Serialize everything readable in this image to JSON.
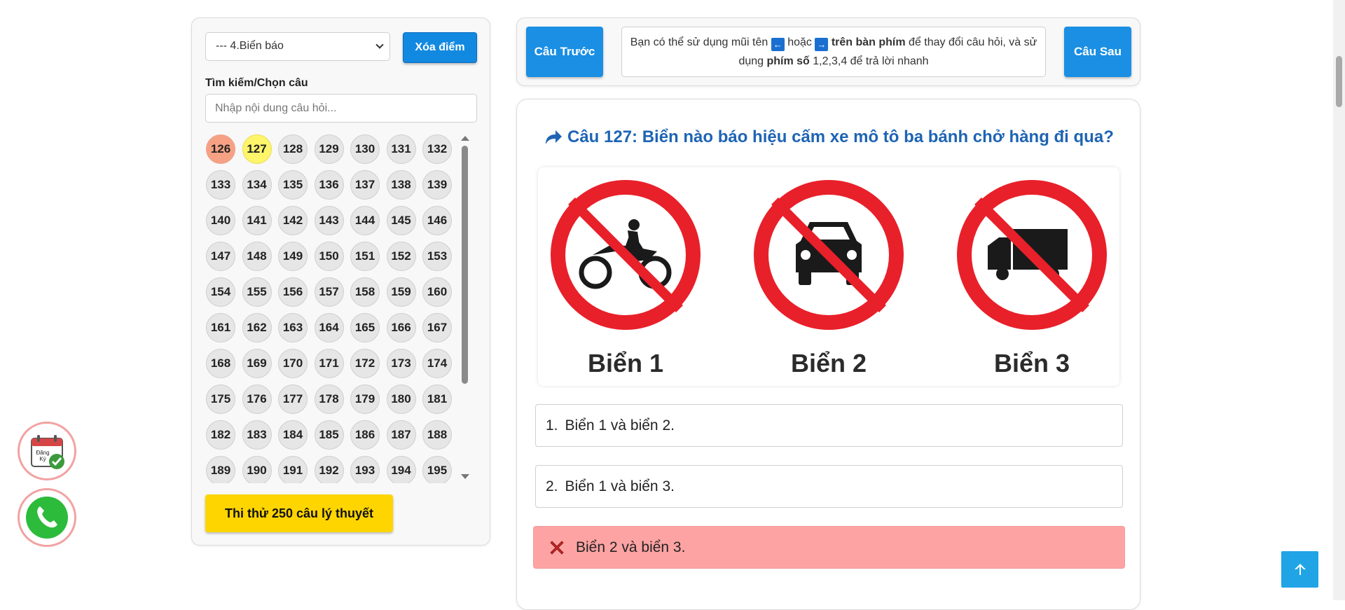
{
  "sidebar": {
    "topic_select": "--- 4.Biển báo",
    "clear_button": "Xóa điểm",
    "search_label": "Tìm kiếm/Chọn câu",
    "search_placeholder": "Nhập nội dung câu hỏi...",
    "question_numbers": [
      "126",
      "127",
      "128",
      "129",
      "130",
      "131",
      "132",
      "133",
      "134",
      "135",
      "136",
      "137",
      "138",
      "139",
      "140",
      "141",
      "142",
      "143",
      "144",
      "145",
      "146",
      "147",
      "148",
      "149",
      "150",
      "151",
      "152",
      "153",
      "154",
      "155",
      "156",
      "157",
      "158",
      "159",
      "160",
      "161",
      "162",
      "163",
      "164",
      "165",
      "166",
      "167",
      "168",
      "169",
      "170",
      "171",
      "172",
      "173",
      "174",
      "175",
      "176",
      "177",
      "178",
      "179",
      "180",
      "181",
      "182",
      "183",
      "184",
      "185",
      "186",
      "187",
      "188",
      "189",
      "190",
      "191",
      "192",
      "193",
      "194",
      "195"
    ],
    "answered_wrong": "126",
    "current": "127",
    "exam_button": "Thi thử 250 câu lý thuyết"
  },
  "nav": {
    "prev_button": "Câu Trước",
    "next_button": "Câu Sau",
    "hint": {
      "part1": "Bạn có thể sử dụng mũi tên",
      "key_left": "←",
      "part2": "hoặc",
      "key_right": "→",
      "bold1": "trên bàn phím",
      "part3": "để thay đổi câu hỏi, và sử dụng",
      "bold2": "phím số",
      "part4": "1,2,3,4 để trả lời nhanh"
    }
  },
  "question": {
    "title": "Câu 127: Biển nào báo hiệu cấm xe mô tô ba bánh chở hàng đi qua?",
    "sign_labels": [
      "Biển 1",
      "Biển 2",
      "Biển 3"
    ],
    "answers": [
      {
        "no": "1.",
        "text": "Biển 1 và biển 2."
      },
      {
        "no": "2.",
        "text": "Biển 1 và biển 3."
      },
      {
        "no": "",
        "text": "Biển 2 và biển 3."
      }
    ]
  },
  "floating": {
    "register_icon_text": "Đăng Ký"
  },
  "colors": {
    "primary_blue": "#1a8fe3",
    "title_blue": "#1e64b4",
    "wrong_bg": "#fea3a3",
    "highlight_yellow": "#fff56b",
    "exam_yellow": "#ffd500"
  }
}
